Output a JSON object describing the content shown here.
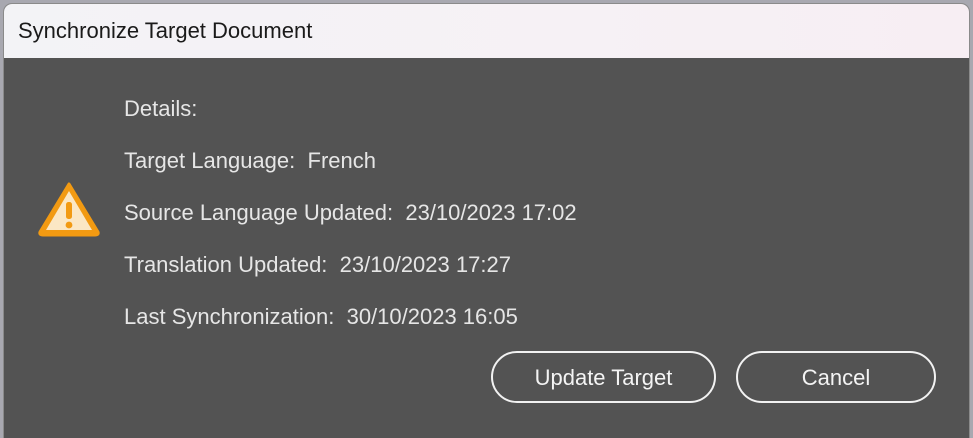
{
  "window": {
    "title": "Synchronize Target Document"
  },
  "icon": {
    "name": "warning-icon",
    "color": "#f29a12"
  },
  "details": {
    "heading": "Details:",
    "target_language_label": "Target Language:",
    "target_language_value": "French",
    "source_updated_label": "Source Language Updated:",
    "source_updated_value": "23/10/2023 17:02",
    "translation_updated_label": "Translation Updated:",
    "translation_updated_value": "23/10/2023 17:27",
    "last_sync_label": "Last Synchronization:",
    "last_sync_value": "30/10/2023 16:05"
  },
  "buttons": {
    "update_label": "Update Target",
    "cancel_label": "Cancel"
  }
}
